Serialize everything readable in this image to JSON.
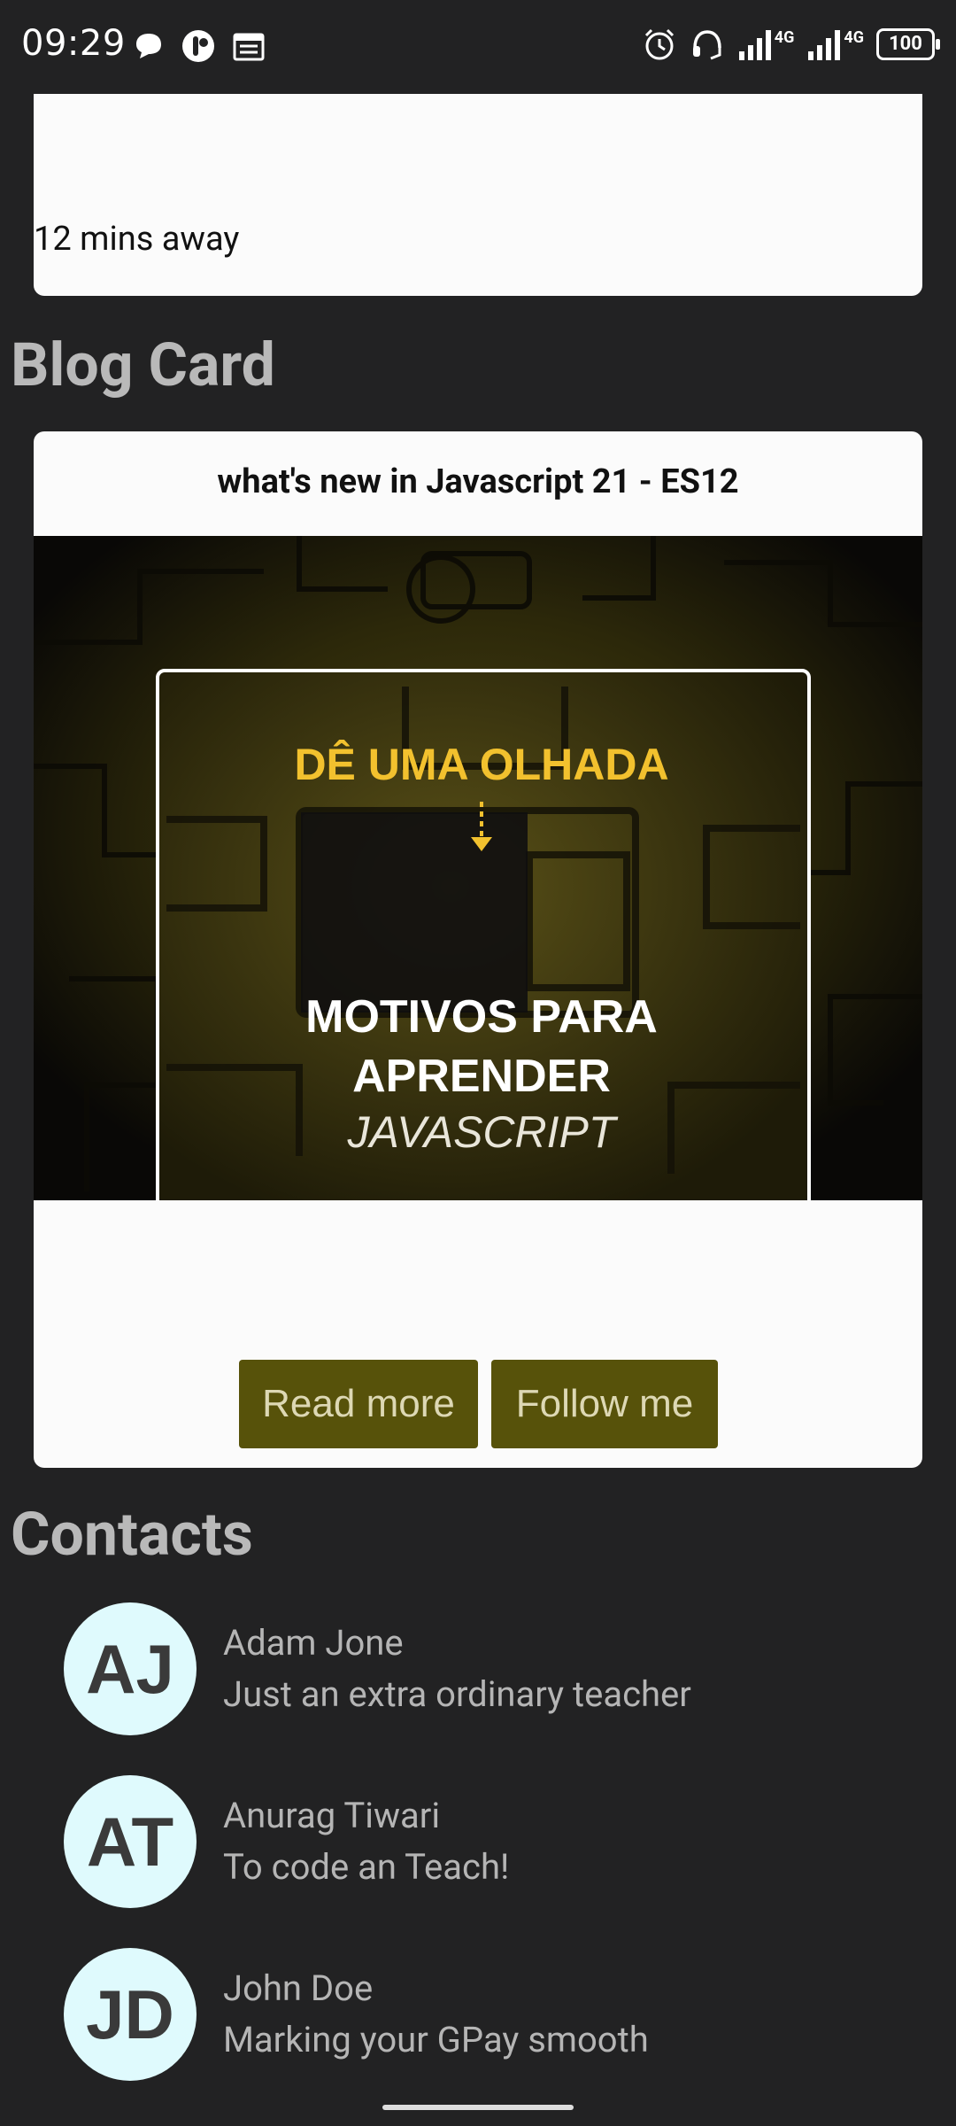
{
  "status_bar": {
    "time": "09:29",
    "battery": "100",
    "network_1": "4G",
    "network_2": "4G",
    "icons": [
      "chat-icon",
      "app-icon",
      "calendar-icon",
      "alarm-icon",
      "headset-icon",
      "signal-icon",
      "signal-icon"
    ]
  },
  "top_card": {
    "eta": "12 mins away"
  },
  "blog_section": {
    "heading": "Blog  Card",
    "card": {
      "title": "what's new in Javascript 21 - ES12",
      "image": {
        "line1": "DÊ UMA OLHADA",
        "line2": "MOTIVOS PARA",
        "line3": "APRENDER",
        "line4": "JAVASCRIPT"
      },
      "read_more": "Read more",
      "follow_me": "Follow me"
    }
  },
  "contacts_section": {
    "heading": "Contacts",
    "contacts": [
      {
        "initials": "AJ",
        "name": "Adam Jone",
        "desc": "Just an extra ordinary teacher"
      },
      {
        "initials": "AT",
        "name": "Anurag Tiwari",
        "desc": "To code an Teach!"
      },
      {
        "initials": "JD",
        "name": "John Doe",
        "desc": "Marking your GPay smooth"
      }
    ]
  },
  "colors": {
    "background": "#222223",
    "card": "#fbfbfb",
    "button": "#57520a",
    "button_text": "#ddd8b4",
    "avatar": "#dffafd",
    "heading": "#b9b9b9",
    "image_yellow": "#f2c12e"
  }
}
